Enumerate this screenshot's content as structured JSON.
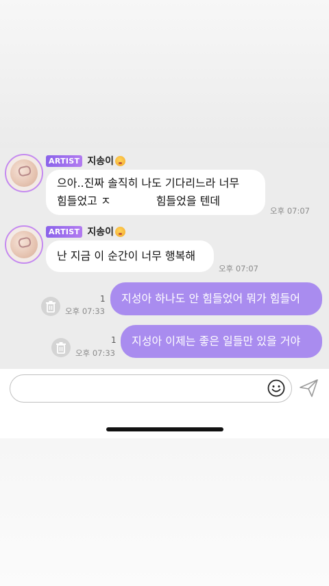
{
  "messages": [
    {
      "sender_badge": "ARTIST",
      "sender_name": "지송이",
      "line1": "으아..진짜 솔직히 나도 기다리느라 너무",
      "line2_start": "힘들었고 ㅈ",
      "line2_end": "힘들었을 텐데",
      "time": "오후 07:07"
    },
    {
      "sender_badge": "ARTIST",
      "sender_name": "지송이",
      "text": "난 지금 이 순간이 너무 행복해",
      "time": "오후 07:07"
    },
    {
      "text": "지성아 하나도 안 힘들었어 뭐가 힘들어",
      "count": "1",
      "time": "오후 07:33"
    },
    {
      "text": "지성아 이제는 좋은 일들만 있을 거야",
      "count": "1",
      "time": "오후 07:33"
    }
  ],
  "composer": {
    "placeholder": "",
    "emoji_icon": "smiley-icon",
    "send_icon": "send-icon"
  },
  "colors": {
    "outgoing_bubble": "#a98cef",
    "badge": "#8a63ea",
    "chat_background": "#ececec"
  }
}
